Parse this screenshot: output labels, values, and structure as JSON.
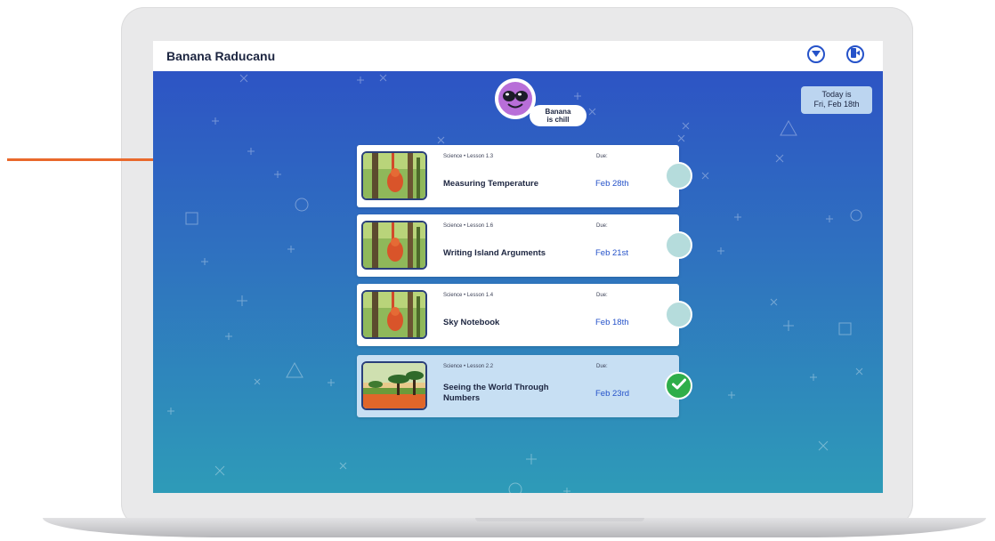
{
  "header": {
    "user_name": "Banana Raducanu",
    "dropdown_icon": "chevron-down-icon",
    "logout_icon": "exit-door-icon"
  },
  "mood": {
    "text_line1": "Banana",
    "text_line2": "is chill",
    "avatar_icon": "sunglasses-face-icon"
  },
  "today": {
    "line1": "Today is",
    "line2": "Fri, Feb 18th"
  },
  "lessons": [
    {
      "meta": "Science • Lesson 1.3",
      "due_label": "Due:",
      "title": "Measuring Temperature",
      "due": "Feb 28th",
      "status": "incomplete"
    },
    {
      "meta": "Science • Lesson 1.6",
      "due_label": "Due:",
      "title": "Writing Island Arguments",
      "due": "Feb 21st",
      "status": "incomplete"
    },
    {
      "meta": "Science • Lesson 1.4",
      "due_label": "Due:",
      "title": "Sky Notebook",
      "due": "Feb 18th",
      "status": "incomplete"
    },
    {
      "meta": "Science • Lesson 2.2",
      "due_label": "Due:",
      "title": "Seeing the World Through Numbers",
      "due": "Feb 23rd",
      "status": "complete"
    }
  ],
  "colors": {
    "accent": "#2552c9",
    "pointer": "#e9692c",
    "complete": "#2fae4a",
    "incomplete": "#b5dcdc"
  }
}
